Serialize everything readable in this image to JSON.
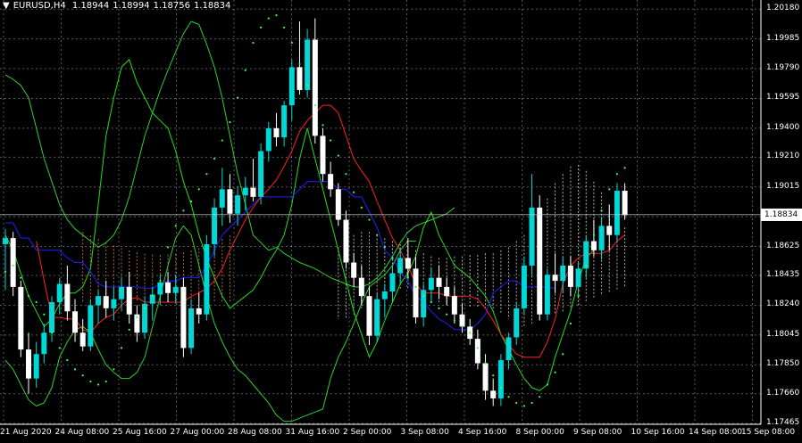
{
  "header": {
    "dropdown_glyph": "▼",
    "symbol": "EURUSD,H4",
    "quote_values": [
      "1.18944",
      "1.18994",
      "1.18756",
      "1.18834"
    ]
  },
  "current_price": "1.18834",
  "colors": {
    "background": "#000000",
    "grid": "#ffffff",
    "bull_candle": "#00d8d8",
    "bear_candle": "#ffffff",
    "tenkan": "#ff2020",
    "kijun": "#2020ff",
    "chikou": "#22dd22",
    "envelope": "#33cc33",
    "kumo_orange": "#ff9955",
    "kumo_white": "#dddddd",
    "sar": "#44ff44"
  },
  "chart_data": {
    "type": "candlestick",
    "symbol": "EURUSD",
    "timeframe": "H4",
    "grid": true,
    "y_ticks": [
      "1.20180",
      "1.19985",
      "1.19790",
      "1.19595",
      "1.19400",
      "1.19210",
      "1.19015",
      "1.18820",
      "1.18625",
      "1.18435",
      "1.18240",
      "1.18045",
      "1.17850",
      "1.17660",
      "1.17465"
    ],
    "ylim": [
      1.1746,
      1.2024
    ],
    "x_ticks": [
      "21 Aug 2020",
      "24 Aug 08:00",
      "25 Aug 16:00",
      "27 Aug 00:00",
      "28 Aug 08:00",
      "31 Aug 16:00",
      "2 Sep 00:00",
      "3 Sep 08:00",
      "4 Sep 16:00",
      "8 Sep 00:00",
      "9 Sep 08:00",
      "10 Sep 16:00",
      "14 Sep 08:00",
      "15 Sep 08:00"
    ],
    "ohlc": [
      [
        1.1864,
        1.1874,
        1.1834,
        1.1868
      ],
      [
        1.1868,
        1.1872,
        1.183,
        1.1836
      ],
      [
        1.1836,
        1.184,
        1.179,
        1.1795
      ],
      [
        1.1795,
        1.1806,
        1.1766,
        1.1776
      ],
      [
        1.1776,
        1.18,
        1.177,
        1.1792
      ],
      [
        1.1792,
        1.1812,
        1.1786,
        1.1806
      ],
      [
        1.1806,
        1.183,
        1.18,
        1.1826
      ],
      [
        1.1826,
        1.1842,
        1.1818,
        1.1838
      ],
      [
        1.1838,
        1.185,
        1.1814,
        1.182
      ],
      [
        1.182,
        1.1828,
        1.18,
        1.1806
      ],
      [
        1.1806,
        1.1815,
        1.1794,
        1.1797
      ],
      [
        1.1797,
        1.1828,
        1.1794,
        1.1824
      ],
      [
        1.1824,
        1.1834,
        1.1812,
        1.183
      ],
      [
        1.183,
        1.184,
        1.1816,
        1.1822
      ],
      [
        1.1822,
        1.1836,
        1.1814,
        1.1828
      ],
      [
        1.1828,
        1.1842,
        1.182,
        1.1836
      ],
      [
        1.1836,
        1.1846,
        1.1812,
        1.1818
      ],
      [
        1.1818,
        1.1824,
        1.18,
        1.1806
      ],
      [
        1.1806,
        1.183,
        1.1802,
        1.1825
      ],
      [
        1.1825,
        1.1836,
        1.1814,
        1.1831
      ],
      [
        1.1831,
        1.1844,
        1.1824,
        1.1839
      ],
      [
        1.1839,
        1.1846,
        1.1826,
        1.1832
      ],
      [
        1.1832,
        1.1844,
        1.1825,
        1.1836
      ],
      [
        1.1836,
        1.1842,
        1.179,
        1.1796
      ],
      [
        1.1796,
        1.1828,
        1.1792,
        1.1822
      ],
      [
        1.1822,
        1.1832,
        1.1812,
        1.1818
      ],
      [
        1.1818,
        1.187,
        1.1814,
        1.1864
      ],
      [
        1.1864,
        1.1894,
        1.1856,
        1.1888
      ],
      [
        1.1888,
        1.1914,
        1.1876,
        1.19
      ],
      [
        1.19,
        1.191,
        1.1878,
        1.1884
      ],
      [
        1.1884,
        1.1902,
        1.1876,
        1.1896
      ],
      [
        1.1896,
        1.1908,
        1.1886,
        1.1901
      ],
      [
        1.1901,
        1.192,
        1.1892,
        1.1895
      ],
      [
        1.1895,
        1.193,
        1.189,
        1.1925
      ],
      [
        1.1925,
        1.1944,
        1.1918,
        1.194
      ],
      [
        1.194,
        1.195,
        1.1928,
        1.1934
      ],
      [
        1.1934,
        1.1958,
        1.1928,
        1.1955
      ],
      [
        1.1955,
        1.1985,
        1.1945,
        1.198
      ],
      [
        1.198,
        1.201,
        1.1962,
        1.1965
      ],
      [
        1.1965,
        1.2005,
        1.196,
        1.1998
      ],
      [
        1.1998,
        1.2012,
        1.193,
        1.1935
      ],
      [
        1.1935,
        1.194,
        1.1905,
        1.191
      ],
      [
        1.191,
        1.1918,
        1.1895,
        1.19
      ],
      [
        1.19,
        1.1904,
        1.1876,
        1.188
      ],
      [
        1.188,
        1.1886,
        1.1848,
        1.1852
      ],
      [
        1.1852,
        1.1858,
        1.1836,
        1.1842
      ],
      [
        1.1842,
        1.185,
        1.1824,
        1.183
      ],
      [
        1.183,
        1.1836,
        1.1798,
        1.1804
      ],
      [
        1.1804,
        1.1832,
        1.18,
        1.1828
      ],
      [
        1.1828,
        1.1838,
        1.1816,
        1.1833
      ],
      [
        1.1833,
        1.185,
        1.1826,
        1.1845
      ],
      [
        1.1845,
        1.1862,
        1.1838,
        1.1855
      ],
      [
        1.1855,
        1.1868,
        1.1842,
        1.1848
      ],
      [
        1.1848,
        1.1856,
        1.1812,
        1.1816
      ],
      [
        1.1816,
        1.1838,
        1.181,
        1.1834
      ],
      [
        1.1834,
        1.1848,
        1.1826,
        1.1842
      ],
      [
        1.1842,
        1.185,
        1.1828,
        1.1836
      ],
      [
        1.1836,
        1.1842,
        1.1824,
        1.183
      ],
      [
        1.183,
        1.1836,
        1.1812,
        1.1818
      ],
      [
        1.1818,
        1.1825,
        1.1806,
        1.181
      ],
      [
        1.181,
        1.1815,
        1.1798,
        1.1802
      ],
      [
        1.1802,
        1.1808,
        1.1782,
        1.1786
      ],
      [
        1.1786,
        1.1792,
        1.1762,
        1.1768
      ],
      [
        1.1768,
        1.1776,
        1.1758,
        1.1763
      ],
      [
        1.1763,
        1.1792,
        1.1758,
        1.1788
      ],
      [
        1.1788,
        1.1806,
        1.1782,
        1.1803
      ],
      [
        1.1803,
        1.1826,
        1.1798,
        1.1822
      ],
      [
        1.1822,
        1.1856,
        1.1818,
        1.185
      ],
      [
        1.185,
        1.191,
        1.1844,
        1.1888
      ],
      [
        1.1888,
        1.1896,
        1.1814,
        1.1818
      ],
      [
        1.1818,
        1.1848,
        1.1814,
        1.1844
      ],
      [
        1.1844,
        1.1858,
        1.1832,
        1.184
      ],
      [
        1.184,
        1.1856,
        1.1832,
        1.185
      ],
      [
        1.185,
        1.1856,
        1.183,
        1.1836
      ],
      [
        1.1836,
        1.1852,
        1.183,
        1.1848
      ],
      [
        1.1848,
        1.187,
        1.1842,
        1.1866
      ],
      [
        1.1866,
        1.188,
        1.1856,
        1.186
      ],
      [
        1.186,
        1.1882,
        1.1854,
        1.1876
      ],
      [
        1.1876,
        1.189,
        1.186,
        1.187
      ],
      [
        1.187,
        1.1904,
        1.1866,
        1.1899
      ],
      [
        1.1899,
        1.1904,
        1.188,
        1.1883
      ]
    ],
    "lines": [
      {
        "key": "tenkan",
        "y": [
          1.1866,
          1.184,
          1.1816,
          1.1816,
          1.1815,
          1.1815,
          1.1808,
          1.1806,
          1.1812,
          1.1816,
          1.1818,
          1.1824,
          1.1828,
          1.1829,
          1.1826,
          1.1826,
          1.1826,
          1.1826,
          1.1826,
          1.1826,
          1.183,
          1.1832,
          1.1835,
          1.184,
          1.1848,
          1.186,
          1.187,
          1.188,
          1.1888,
          1.1895,
          1.19,
          1.1906,
          1.1915,
          1.1925,
          1.1938,
          1.1945,
          1.195,
          1.1955,
          1.1955,
          1.195,
          1.1935,
          1.192,
          1.1912,
          1.1905,
          1.1892,
          1.188,
          1.1868,
          1.186,
          1.185,
          1.1838,
          1.1832,
          1.1832,
          1.1832,
          1.183,
          1.183,
          1.183,
          1.183,
          1.1828,
          1.1822,
          1.1814,
          1.1805,
          1.1798,
          1.1792,
          1.179,
          1.179,
          1.179,
          1.18,
          1.1815,
          1.1838,
          1.185,
          1.1855,
          1.1858,
          1.1858,
          1.1858,
          1.186,
          1.1866,
          1.187
        ]
      },
      {
        "key": "kijun",
        "y": [
          1.1878,
          1.1878,
          1.1868,
          1.1868,
          1.186,
          1.186,
          1.186,
          1.186,
          1.1855,
          1.1852,
          1.1852,
          1.1846,
          1.1838,
          1.1836,
          1.1836,
          1.1836,
          1.1836,
          1.1836,
          1.1835,
          1.1835,
          1.1838,
          1.184,
          1.184,
          1.1842,
          1.1842,
          1.1842,
          1.185,
          1.186,
          1.187,
          1.1875,
          1.188,
          1.1885,
          1.189,
          1.1895,
          1.1895,
          1.1895,
          1.1895,
          1.1895,
          1.19,
          1.1905,
          1.1905,
          1.1905,
          1.1905,
          1.19,
          1.19,
          1.1895,
          1.1895,
          1.1885,
          1.1875,
          1.186,
          1.1855,
          1.1846,
          1.184,
          1.183,
          1.1826,
          1.182,
          1.1815,
          1.1812,
          1.1808,
          1.1808,
          1.1808,
          1.1812,
          1.1818,
          1.1832,
          1.1836,
          1.184,
          1.184,
          1.1836,
          1.1836,
          1.1836,
          1.1836,
          1.1835
        ]
      },
      {
        "key": "chikou",
        "y": [
          1.187,
          1.186,
          1.1845,
          1.183,
          1.182,
          1.181,
          1.1815,
          1.1825,
          1.1832,
          1.1832,
          1.1836,
          1.1848,
          1.189,
          1.1935,
          1.196,
          1.198,
          1.1985,
          1.197,
          1.196,
          1.195,
          1.1945,
          1.194,
          1.1925,
          1.1905,
          1.189,
          1.187,
          1.1855,
          1.1842,
          1.183,
          1.1822,
          1.1826,
          1.183,
          1.1834,
          1.1842,
          1.1852,
          1.186,
          1.187,
          1.189,
          1.192,
          1.194,
          1.192,
          1.19,
          1.188,
          1.186,
          1.184,
          1.182,
          1.1805,
          1.179,
          1.18,
          1.1814,
          1.1826,
          1.1838,
          1.1845,
          1.1856,
          1.1875,
          1.1885,
          1.187,
          1.186,
          1.185,
          1.1846,
          1.1842,
          1.1836,
          1.183,
          1.182,
          1.1805,
          1.1795,
          1.1785,
          1.1776,
          1.177,
          1.1768,
          1.1772,
          1.179,
          1.1805,
          1.182,
          1.184,
          1.1855,
          1.186
        ]
      },
      {
        "key": "env_upper",
        "y": [
          1.1975,
          1.1972,
          1.1968,
          1.196,
          1.194,
          1.192,
          1.1905,
          1.189,
          1.188,
          1.1874,
          1.187,
          1.1866,
          1.1862,
          1.1865,
          1.187,
          1.188,
          1.1895,
          1.1915,
          1.1935,
          1.195,
          1.1965,
          1.1978,
          1.199,
          1.2002,
          1.201,
          1.2008,
          1.1995,
          1.198,
          1.196,
          1.1935,
          1.191,
          1.189,
          1.187,
          1.1865,
          1.186,
          1.1862,
          1.1858,
          1.1855,
          1.1852,
          1.185,
          1.1848,
          1.1845,
          1.1842,
          1.184,
          1.1838,
          1.1836,
          1.1836,
          1.1838,
          1.1842,
          1.1848,
          1.1856,
          1.1865,
          1.1872,
          1.1876,
          1.1878,
          1.188,
          1.1882,
          1.1884,
          1.1888
        ]
      },
      {
        "key": "env_lower",
        "y": [
          1.1788,
          1.1782,
          1.1772,
          1.1762,
          1.1758,
          1.176,
          1.177,
          1.179,
          1.18,
          1.1808,
          1.181,
          1.1806,
          1.1795,
          1.1785,
          1.178,
          1.1776,
          1.1776,
          1.178,
          1.179,
          1.181,
          1.183,
          1.185,
          1.1868,
          1.1876,
          1.187,
          1.185,
          1.183,
          1.1812,
          1.18,
          1.179,
          1.1782,
          1.1778,
          1.1772,
          1.1766,
          1.176,
          1.1752,
          1.1748,
          1.1748,
          1.175,
          1.1752,
          1.1754,
          1.1756,
          1.1776,
          1.179,
          1.18,
          1.1812,
          1.1825,
          1.1836,
          1.184,
          1.1844,
          1.185,
          1.186,
          1.1866,
          1.1866
        ]
      },
      {
        "key": "kumo_a",
        "y": [
          1.1862,
          1.1866,
          1.187,
          1.1872,
          1.1872,
          1.187,
          1.1868,
          1.1866,
          1.1864,
          1.1862,
          1.186,
          1.1858,
          1.1856,
          1.1855,
          1.1855,
          1.1856,
          1.1856,
          1.1857,
          1.1857,
          1.1858,
          1.1858,
          1.186,
          1.1862,
          1.1866,
          1.187,
          1.1876,
          1.1884,
          1.1894,
          1.1904,
          1.191,
          1.1915,
          1.1916,
          1.1912,
          1.1905,
          1.1898,
          1.189,
          1.188,
          1.1875
        ]
      },
      {
        "key": "kumo_b",
        "y": [
          1.1815,
          1.1815,
          1.1818,
          1.1822,
          1.1826,
          1.1828,
          1.183,
          1.1832,
          1.1834,
          1.1834,
          1.1832,
          1.183,
          1.1828,
          1.1826,
          1.1824,
          1.1823,
          1.1823,
          1.1823,
          1.1822,
          1.1822,
          1.182,
          1.1818,
          1.1815,
          1.1812,
          1.181,
          1.1812,
          1.1814,
          1.1816,
          1.1818,
          1.182,
          1.1822,
          1.1824,
          1.1826,
          1.1828,
          1.183,
          1.1832,
          1.1834,
          1.1836
        ]
      }
    ],
    "sar": [
      1.1846,
      1.185,
      1.1842,
      1.183,
      1.1826,
      1.1818,
      1.1806,
      1.1796,
      1.1788,
      1.1782,
      1.1778,
      1.1774,
      1.1772,
      1.1774,
      1.1782,
      1.1796,
      1.1808,
      1.1816,
      1.1822,
      1.183,
      1.184,
      1.1862,
      1.1876,
      1.1886,
      1.1892,
      1.19,
      1.191,
      1.192,
      1.1932,
      1.1944,
      1.196,
      1.1978,
      1.1996,
      1.2006,
      1.2012,
      1.2014,
      1.2006,
      1.1996,
      1.1982,
      1.1968,
      1.1955,
      1.1942,
      1.1932,
      1.1922,
      1.191,
      1.1898,
      1.1888,
      1.188,
      1.187,
      1.1862,
      1.1855,
      1.1848,
      1.1842,
      1.1836,
      1.183,
      1.1826,
      1.1822,
      1.1818,
      1.1814,
      1.181,
      1.1806,
      1.1796,
      1.1786,
      1.1778,
      1.177,
      1.1764,
      1.176,
      1.1758,
      1.176,
      1.1764,
      1.1772,
      1.178,
      1.1792,
      1.1812,
      1.183,
      1.185,
      1.187,
      1.1886,
      1.19,
      1.191,
      1.1914
    ]
  }
}
